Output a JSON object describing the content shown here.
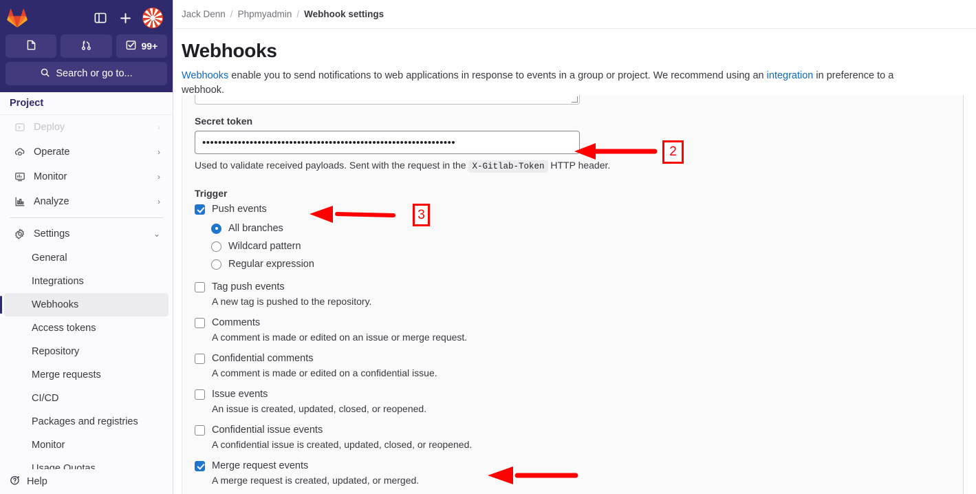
{
  "sidebar": {
    "logo_icon": "gitlab-logo-icon",
    "top_icons": [
      {
        "name": "sidebar-toggle-icon",
        "label": ""
      },
      {
        "name": "new-item-plus-icon",
        "label": ""
      },
      {
        "name": "user-avatar",
        "label": ""
      }
    ],
    "quick_buttons": [
      {
        "name": "issues-button",
        "icon": "issues-icon",
        "label": ""
      },
      {
        "name": "merge-requests-button",
        "icon": "merge-request-icon",
        "label": ""
      },
      {
        "name": "todos-button",
        "icon": "todo-checkbox-icon",
        "label": "99+"
      }
    ],
    "search": {
      "placeholder": "Search or go to...",
      "icon": "search-icon"
    },
    "section_header": "Project",
    "nav_items": [
      {
        "label": "Deploy",
        "icon": "deploy-icon",
        "chevron": "›",
        "faded": true
      },
      {
        "label": "Operate",
        "icon": "operate-icon",
        "chevron": "›",
        "faded": false
      },
      {
        "label": "Monitor",
        "icon": "monitor-icon",
        "chevron": "›",
        "faded": false
      },
      {
        "label": "Analyze",
        "icon": "analyze-icon",
        "chevron": "›",
        "faded": false
      },
      {
        "label": "Settings",
        "icon": "settings-gear-icon",
        "chevron": "⌄",
        "faded": false
      }
    ],
    "settings_subitems": [
      {
        "label": "General",
        "active": false
      },
      {
        "label": "Integrations",
        "active": false
      },
      {
        "label": "Webhooks",
        "active": true
      },
      {
        "label": "Access tokens",
        "active": false
      },
      {
        "label": "Repository",
        "active": false
      },
      {
        "label": "Merge requests",
        "active": false
      },
      {
        "label": "CI/CD",
        "active": false
      },
      {
        "label": "Packages and registries",
        "active": false
      },
      {
        "label": "Monitor",
        "active": false
      },
      {
        "label": "Usage Quotas",
        "active": false
      }
    ],
    "help": {
      "label": "Help",
      "icon": "help-question-icon"
    }
  },
  "breadcrumb": {
    "items": [
      "Jack Denn",
      "Phpmyadmin"
    ],
    "separator": "/",
    "current": "Webhook settings"
  },
  "page": {
    "title": "Webhooks",
    "desc_link_1": "Webhooks",
    "desc_part_1": " enable you to send notifications to web applications in response to events in a group or project. We recommend using an ",
    "desc_link_2": "integration",
    "desc_part_2": " in preference to a webhook."
  },
  "form": {
    "secret_token": {
      "label": "Secret token",
      "value": "••••••••••••••••••••••••••••••••••••••••••••••••••••••••••••••••",
      "hint_before": "Used to validate received payloads. Sent with the request in the ",
      "hint_code": "X-Gitlab-Token",
      "hint_after": " HTTP header."
    },
    "trigger_label": "Trigger",
    "push_events": {
      "label": "Push events",
      "checked": true,
      "branch_options": [
        {
          "label": "All branches",
          "selected": true
        },
        {
          "label": "Wildcard pattern",
          "selected": false
        },
        {
          "label": "Regular expression",
          "selected": false
        }
      ]
    },
    "events": [
      {
        "label": "Tag push events",
        "desc": "A new tag is pushed to the repository.",
        "checked": false
      },
      {
        "label": "Comments",
        "desc": "A comment is made or edited on an issue or merge request.",
        "checked": false
      },
      {
        "label": "Confidential comments",
        "desc": "A comment is made or edited on a confidential issue.",
        "checked": false
      },
      {
        "label": "Issue events",
        "desc": "An issue is created, updated, closed, or reopened.",
        "checked": false
      },
      {
        "label": "Confidential issue events",
        "desc": "A confidential issue is created, updated, closed, or reopened.",
        "checked": false
      },
      {
        "label": "Merge request events",
        "desc": "A merge request is created, updated, or merged.",
        "checked": true
      }
    ]
  },
  "annotations": {
    "color": "#ff0000",
    "markers": [
      {
        "number": "2",
        "target": "secret-token-input"
      },
      {
        "number": "3",
        "target": "push-events-checkbox"
      }
    ],
    "arrows": [
      {
        "points_to": "secret-token-input"
      },
      {
        "points_to": "push-events-checkbox"
      },
      {
        "points_to": "merge-request-events-checkbox"
      }
    ]
  }
}
